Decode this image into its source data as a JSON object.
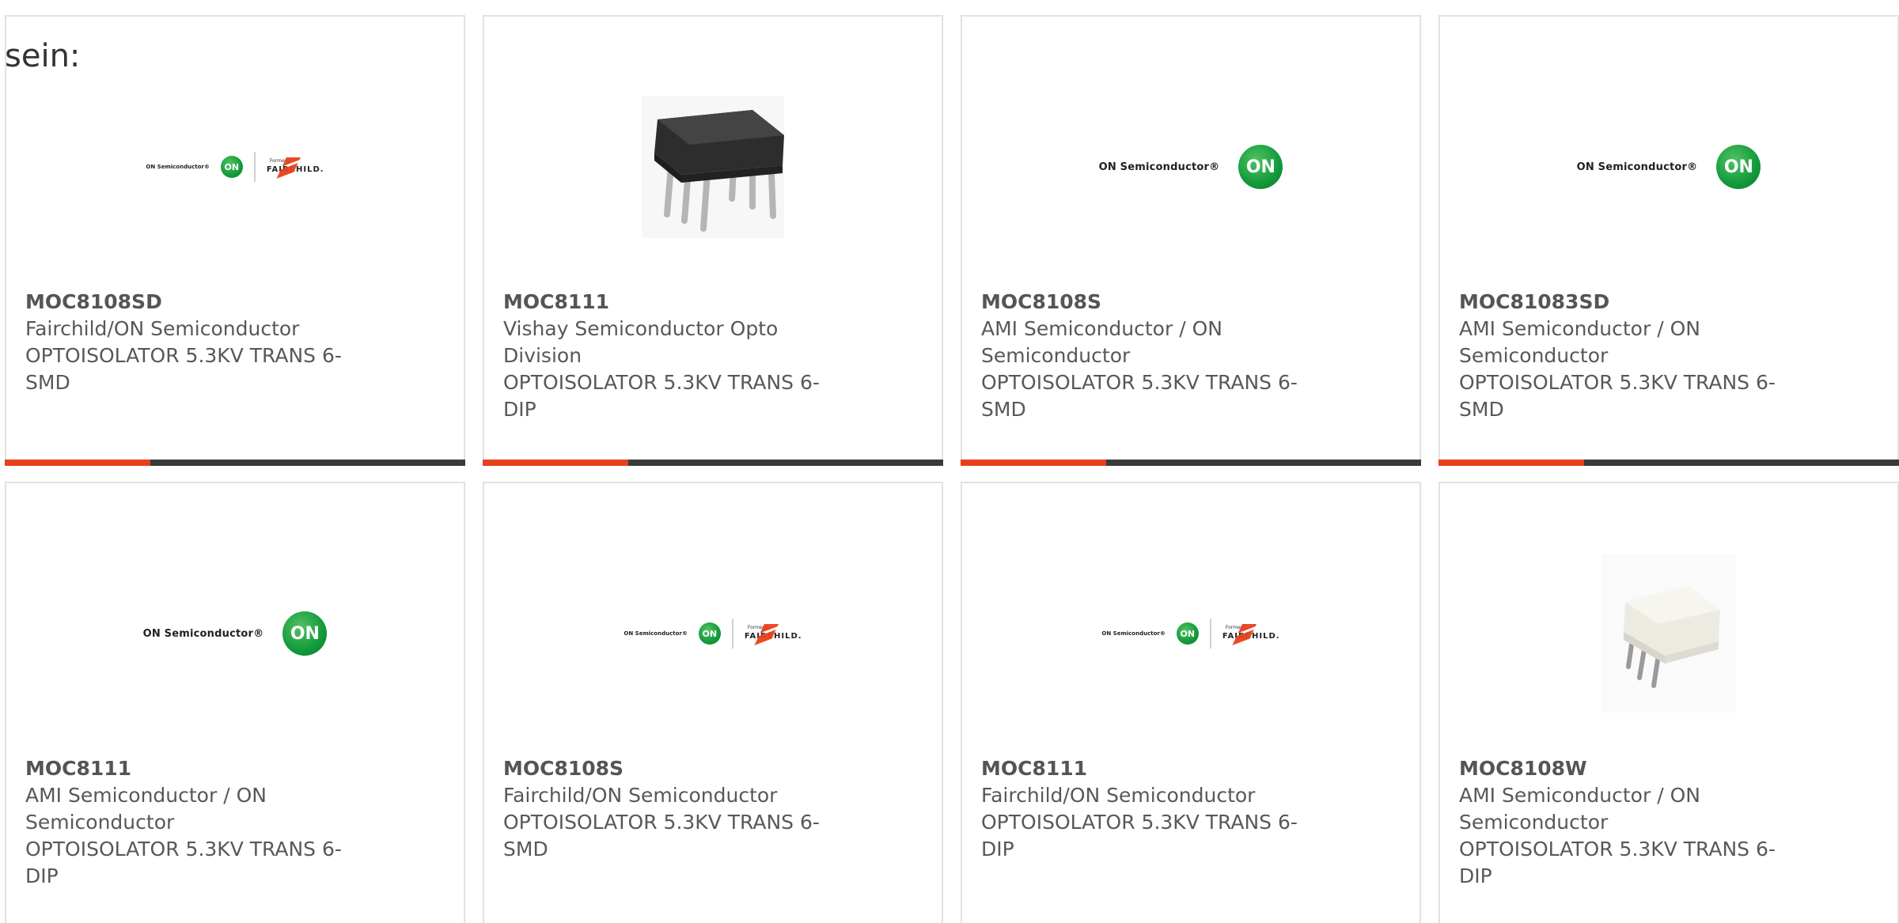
{
  "intro_text": "sein:",
  "colors": {
    "accent": "#e8401c",
    "bar": "#3a3a3a",
    "border": "#e2e2e2",
    "text": "#585858"
  },
  "products": [
    {
      "part": "MOC8108SD",
      "manufacturer": "Fairchild/ON Semiconductor",
      "description": "OPTOISOLATOR 5.3KV TRANS 6-SMD",
      "image": "on-fairchild-logo"
    },
    {
      "part": "MOC8111",
      "manufacturer": "Vishay Semiconductor Opto Division",
      "description": "OPTOISOLATOR 5.3KV TRANS 6-DIP",
      "image": "black-dip-chip"
    },
    {
      "part": "MOC8108S",
      "manufacturer": "AMI Semiconductor / ON Semiconductor",
      "description": "OPTOISOLATOR 5.3KV TRANS 6-SMD",
      "image": "on-semiconductor-logo"
    },
    {
      "part": "MOC81083SD",
      "manufacturer": "AMI Semiconductor / ON Semiconductor",
      "description": "OPTOISOLATOR 5.3KV TRANS 6-SMD",
      "image": "on-semiconductor-logo"
    },
    {
      "part": "MOC8111",
      "manufacturer": "AMI Semiconductor / ON Semiconductor",
      "description": "OPTOISOLATOR 5.3KV TRANS 6-DIP",
      "image": "on-semiconductor-logo"
    },
    {
      "part": "MOC8108S",
      "manufacturer": "Fairchild/ON Semiconductor",
      "description": "OPTOISOLATOR 5.3KV TRANS 6-SMD",
      "image": "on-fairchild-logo"
    },
    {
      "part": "MOC8111",
      "manufacturer": "Fairchild/ON Semiconductor",
      "description": "OPTOISOLATOR 5.3KV TRANS 6-DIP",
      "image": "on-fairchild-logo"
    },
    {
      "part": "MOC8108W",
      "manufacturer": "AMI Semiconductor / ON Semiconductor",
      "description": "OPTOISOLATOR 5.3KV TRANS 6-DIP",
      "image": "white-dip-chip"
    }
  ],
  "logo": {
    "on_text": "ON Semiconductor®",
    "on_mark": "ON",
    "formerly": "Formerly",
    "fairchild": "FAIRCHILD."
  }
}
